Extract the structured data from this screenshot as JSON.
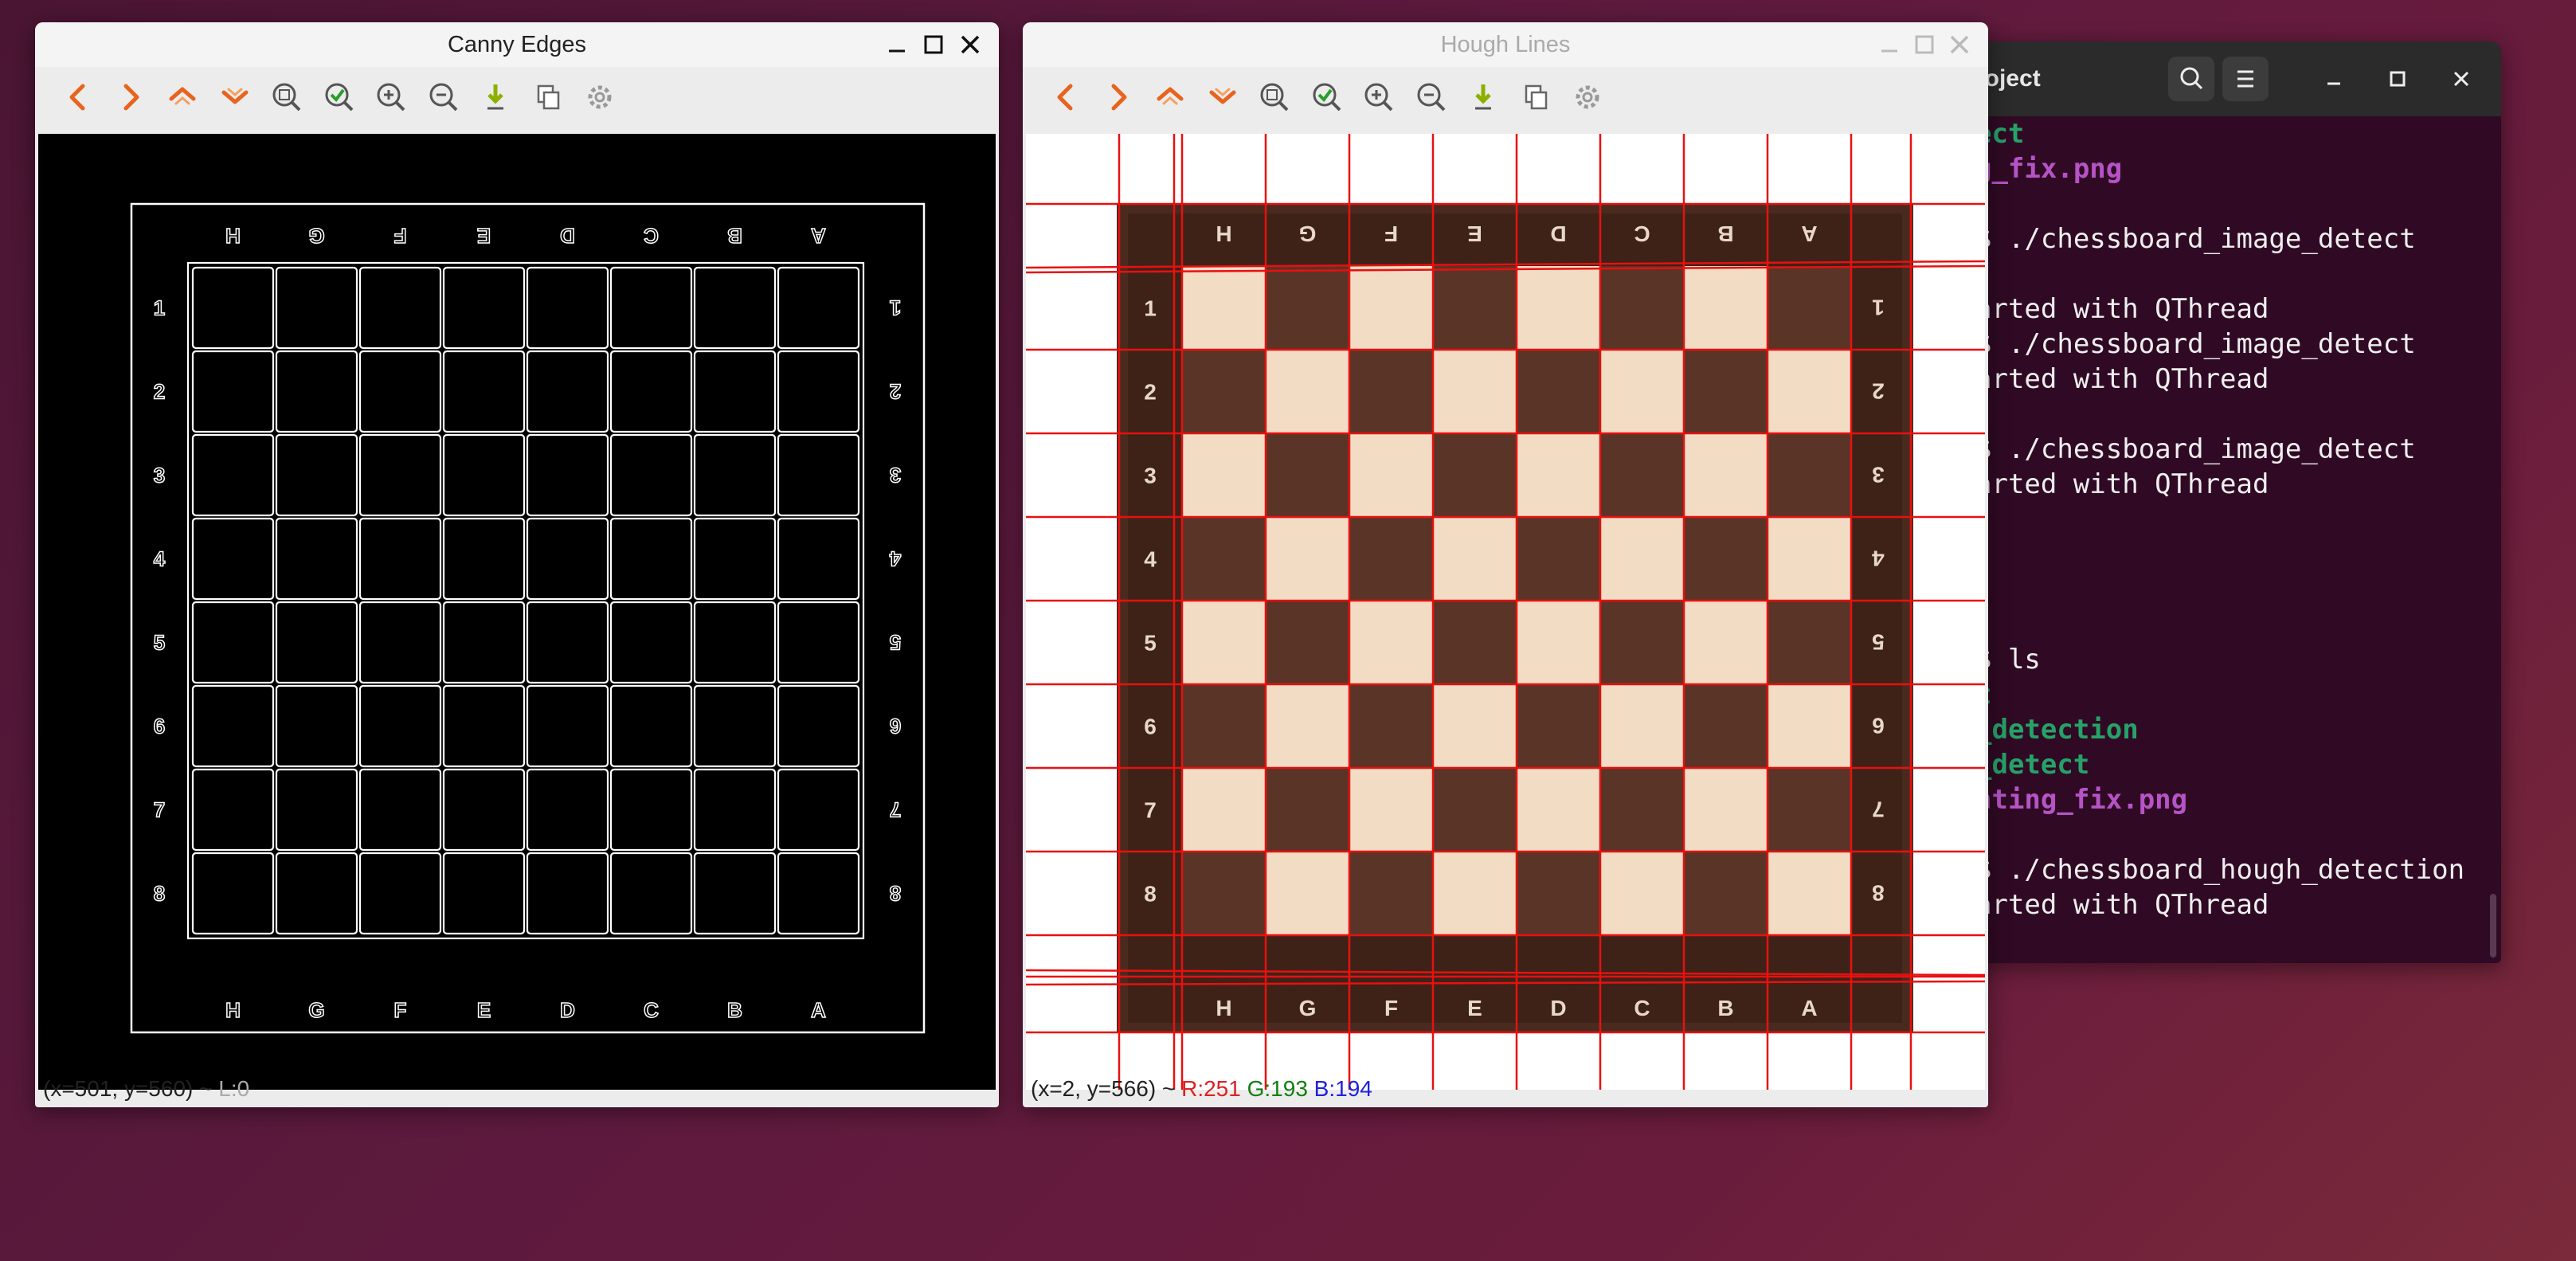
{
  "canny_window": {
    "title": "Canny Edges",
    "status": "(x=501, y=560) ~ ",
    "status_dim": "L:0",
    "file_labels": [
      "H",
      "G",
      "F",
      "E",
      "D",
      "C",
      "B",
      "A"
    ],
    "rank_labels": [
      "1",
      "2",
      "3",
      "4",
      "5",
      "6",
      "7",
      "8"
    ]
  },
  "hough_window": {
    "title": "Hough Lines",
    "status_pos": "(x=2, y=566) ~ ",
    "status_r": "R:251",
    "status_g": "G:193",
    "status_b": "B:194",
    "file_labels": [
      "H",
      "G",
      "F",
      "E",
      "D",
      "C",
      "B",
      "A"
    ],
    "rank_labels": [
      "1",
      "2",
      "3",
      "4",
      "5",
      "6",
      "7",
      "8"
    ],
    "line_color": "#e81010",
    "light_square": "#f2dcc4",
    "dark_square": "#5a3426"
  },
  "toolbar_icons": [
    "pan-left-icon",
    "pan-right-icon",
    "pan-up-icon",
    "pan-down-icon",
    "zoom-fit-icon",
    "zoom-original-icon",
    "zoom-in-icon",
    "zoom-out-icon",
    "save-image-icon",
    "copy-icon",
    "properties-icon"
  ],
  "terminal": {
    "title": "roject",
    "lines": [
      {
        "segments": [
          {
            "t": "ect",
            "c": "green"
          }
        ]
      },
      {
        "segments": [
          {
            "t": "g_fix.png",
            "c": "purple"
          }
        ]
      },
      {
        "segments": [
          {
            "t": "",
            "c": ""
          }
        ]
      },
      {
        "segments": [
          {
            "t": "$ ./chessboard_image_detect",
            "c": ""
          }
        ]
      },
      {
        "segments": [
          {
            "t": "",
            "c": ""
          }
        ]
      },
      {
        "segments": [
          {
            "t": "arted with QThread",
            "c": ""
          }
        ]
      },
      {
        "segments": [
          {
            "t": "$ ./chessboard_image_detect",
            "c": ""
          }
        ]
      },
      {
        "segments": [
          {
            "t": "arted with QThread",
            "c": ""
          }
        ]
      },
      {
        "segments": [
          {
            "t": "",
            "c": ""
          }
        ]
      },
      {
        "segments": [
          {
            "t": "$ ./chessboard_image_detect",
            "c": ""
          }
        ]
      },
      {
        "segments": [
          {
            "t": "arted with QThread",
            "c": ""
          }
        ]
      },
      {
        "segments": [
          {
            "t": "",
            "c": ""
          }
        ]
      },
      {
        "segments": [
          {
            "t": "",
            "c": ""
          }
        ]
      },
      {
        "segments": [
          {
            "t": "",
            "c": ""
          }
        ]
      },
      {
        "segments": [
          {
            "t": "",
            "c": ""
          }
        ]
      },
      {
        "segments": [
          {
            "t": "$ ls",
            "c": ""
          }
        ]
      },
      {
        "segments": [
          {
            "t": "t",
            "c": "green"
          }
        ]
      },
      {
        "segments": [
          {
            "t": "_detection",
            "c": "green"
          }
        ]
      },
      {
        "segments": [
          {
            "t": "_detect",
            "c": "green"
          }
        ]
      },
      {
        "segments": [
          {
            "t": "hting_fix.png",
            "c": "purple"
          }
        ]
      },
      {
        "segments": [
          {
            "t": "",
            "c": ""
          }
        ]
      },
      {
        "segments": [
          {
            "t": "$ ./chessboard_hough_detection",
            "c": ""
          }
        ]
      },
      {
        "segments": [
          {
            "t": "arted with QThread",
            "c": ""
          }
        ]
      }
    ]
  }
}
